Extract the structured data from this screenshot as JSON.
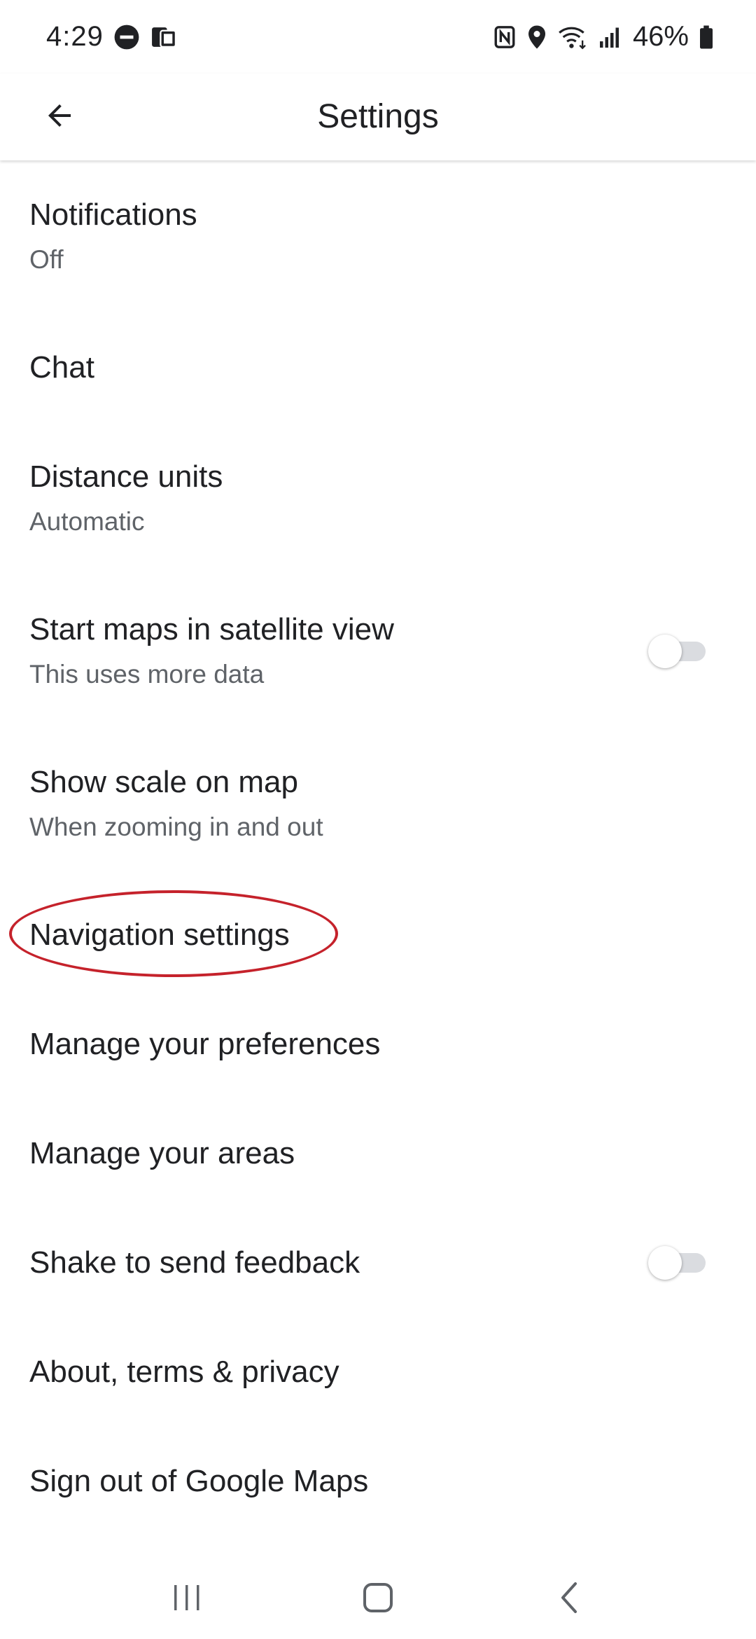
{
  "status_bar": {
    "time": "4:29",
    "battery_percent": "46%",
    "icons": [
      "do-not-disturb-icon",
      "device-icon",
      "nfc-icon",
      "location-icon",
      "wifi-icon",
      "signal-icon",
      "battery-icon"
    ]
  },
  "app_bar": {
    "title": "Settings",
    "back_icon": "arrow-back-icon"
  },
  "settings": [
    {
      "id": "notifications",
      "title": "Notifications",
      "subtitle": "Off"
    },
    {
      "id": "chat",
      "title": "Chat"
    },
    {
      "id": "distance-units",
      "title": "Distance units",
      "subtitle": "Automatic"
    },
    {
      "id": "satellite-view",
      "title": "Start maps in satellite view",
      "subtitle": "This uses more data",
      "toggle": false
    },
    {
      "id": "show-scale",
      "title": "Show scale on map",
      "subtitle": "When zooming in and out"
    },
    {
      "id": "navigation-settings",
      "title": "Navigation settings",
      "annotated": true
    },
    {
      "id": "manage-preferences",
      "title": "Manage your preferences"
    },
    {
      "id": "manage-areas",
      "title": "Manage your areas"
    },
    {
      "id": "shake-feedback",
      "title": "Shake to send feedback",
      "toggle": false
    },
    {
      "id": "about",
      "title": "About, terms & privacy"
    },
    {
      "id": "sign-out",
      "title": "Sign out of Google Maps"
    }
  ],
  "colors": {
    "annotation": "#c5222b",
    "text_primary": "#202124",
    "text_secondary": "#5f6368",
    "toggle_track_off": "#dadce0"
  },
  "nav_bar": {
    "icons": [
      "recent-apps-icon",
      "home-icon",
      "back-icon"
    ]
  }
}
